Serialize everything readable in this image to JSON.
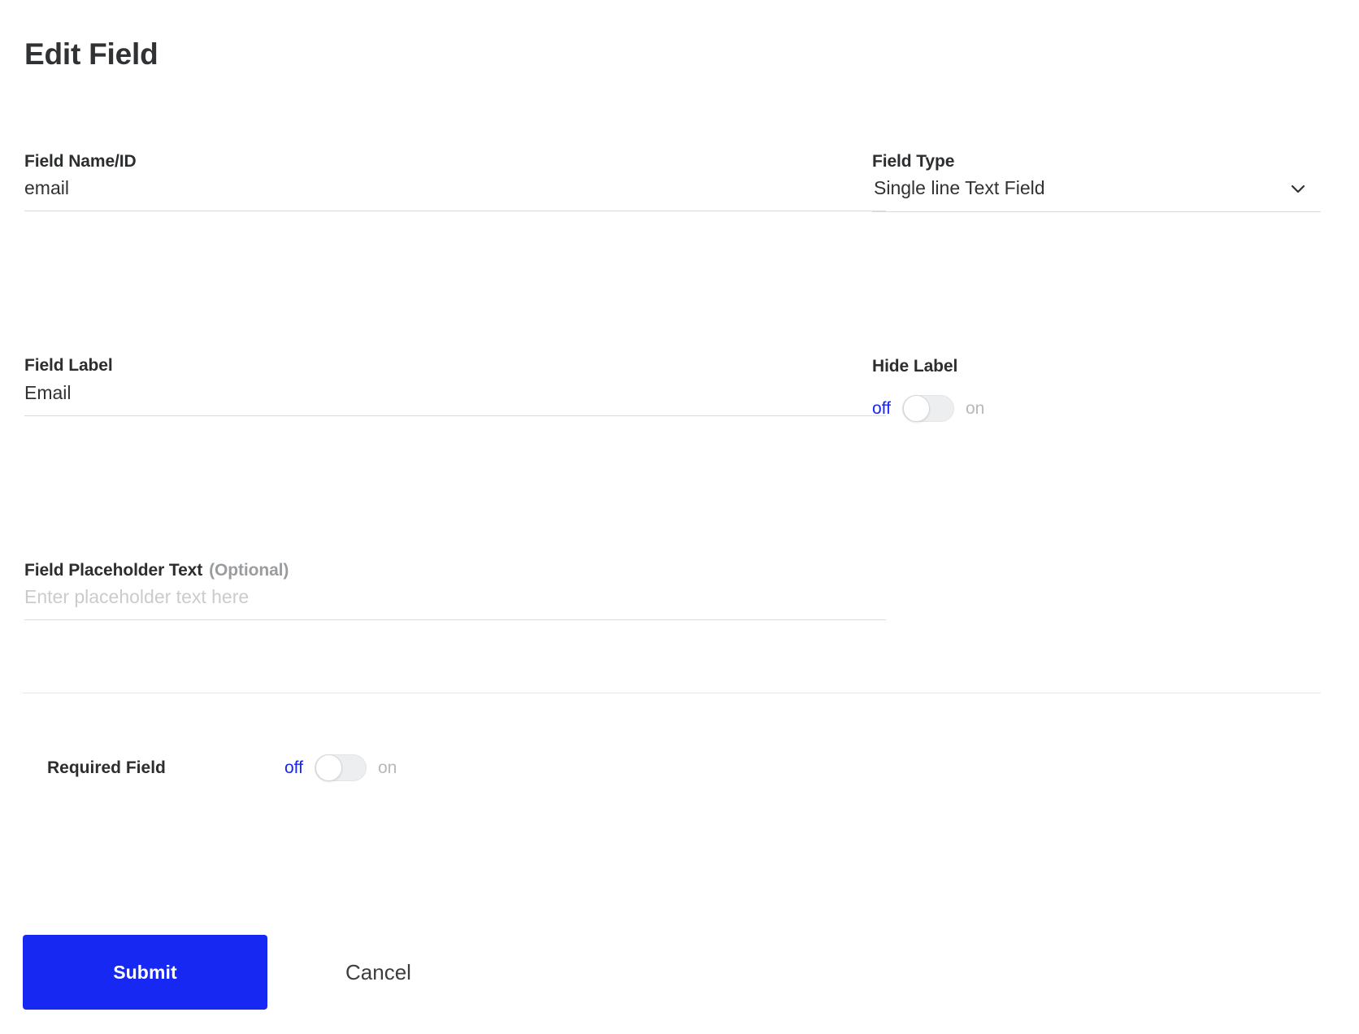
{
  "header": {
    "title": "Edit Field"
  },
  "form": {
    "field_name": {
      "label": "Field Name/ID",
      "value": "email",
      "placeholder": ""
    },
    "field_type": {
      "label": "Field Type",
      "value": "Single line Text Field",
      "icon": "chevron-down-icon"
    },
    "field_label": {
      "label": "Field Label",
      "value": "Email",
      "placeholder": ""
    },
    "hide_label": {
      "label": "Hide Label",
      "off_text": "off",
      "on_text": "on",
      "state": "off"
    },
    "field_placeholder": {
      "label": "Field Placeholder Text",
      "optional_suffix": "(Optional)",
      "value": "",
      "placeholder": "Enter placeholder text here"
    },
    "required_field": {
      "label": "Required Field",
      "off_text": "off",
      "on_text": "on",
      "state": "off"
    }
  },
  "actions": {
    "submit_label": "Submit",
    "cancel_label": "Cancel"
  },
  "colors": {
    "accent_blue": "#1728f2",
    "toggle_active_text": "#1726ef",
    "toggle_inactive_text": "#b6b9bc",
    "label_text": "#2b2d2f",
    "muted_text": "#9a9da0",
    "placeholder_text": "#c9ccce",
    "input_underline": "#d9dbdd",
    "divider": "#e4e6e8"
  }
}
